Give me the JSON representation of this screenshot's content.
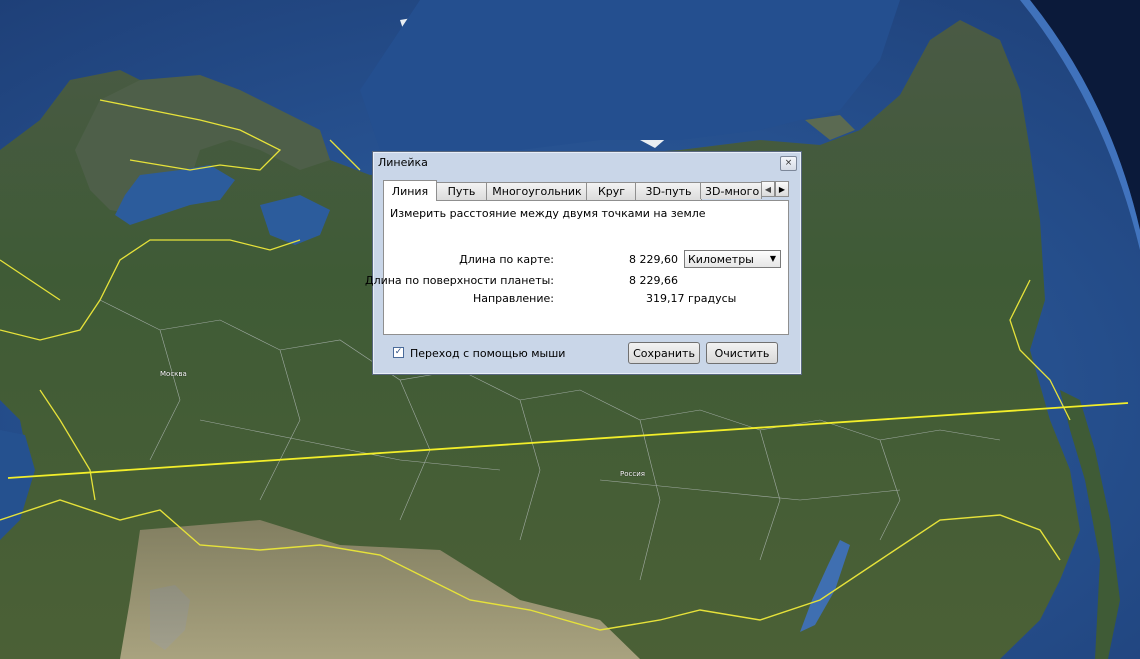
{
  "dialog": {
    "title": "Линейка",
    "close_glyph": "×",
    "tabs": [
      {
        "label": "Линия",
        "active": true
      },
      {
        "label": "Путь",
        "active": false
      },
      {
        "label": "Многоугольник",
        "active": false
      },
      {
        "label": "Круг",
        "active": false
      },
      {
        "label": "3D-путь",
        "active": false
      },
      {
        "label": "3D-много",
        "active": false
      }
    ],
    "description": "Измерить расстояние между двумя точками на земле",
    "map_length_label": "Длина по карте:",
    "map_length_value": "8 229,60",
    "units": {
      "selected": "Километры"
    },
    "surface_length_label": "Длина по поверхности планеты:",
    "surface_length_value": "8 229,66",
    "heading_label": "Направление:",
    "heading_value": "319,17 градусы",
    "mouse_nav_label": "Переход с помощью мыши",
    "mouse_nav_checked": true,
    "save_label": "Сохранить",
    "clear_label": "Очистить"
  },
  "map": {
    "labels": [
      {
        "name": "country-label-russia",
        "text": "Россия"
      },
      {
        "name": "city-label-moscow",
        "text": "Москва"
      }
    ],
    "colors": {
      "ocean": "#25518f",
      "land": "#3d5a34",
      "border": "#e6e23a",
      "ruler_line": "#f2ee2a"
    }
  }
}
